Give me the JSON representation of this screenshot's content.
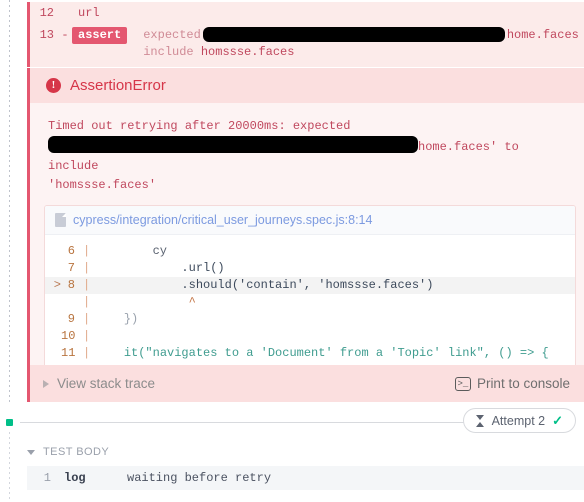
{
  "command_log": {
    "rows": [
      {
        "number": "12",
        "dash": "",
        "name": "url",
        "is_assert": false,
        "message": ""
      },
      {
        "number": "13",
        "dash": "-",
        "name": "assert",
        "is_assert": true,
        "message_pre": "expected",
        "message_redacted_tail": "home.faces to",
        "message_line2_label": "include",
        "message_line2_value": "homssse.faces"
      }
    ]
  },
  "error": {
    "icon": "error-circle-icon",
    "title": "AssertionError",
    "message_line1": "Timed out retrying after 20000ms: expected",
    "message_line2_tail": "home.faces' to include",
    "message_line3": "'homssse.faces'",
    "accent_color": "#e45770",
    "title_color": "#d63649",
    "header_bg": "#fbdfdf",
    "body_bg": "#fdf3f3"
  },
  "code_frame": {
    "file_icon": "file-icon",
    "file_path": "cypress/integration/critical_user_journeys.spec.js:8:14",
    "file_link_color": "#7c9ae0",
    "lines": [
      {
        "marker": "",
        "number": "6",
        "pipe": "|",
        "indent": 8,
        "text": "cy",
        "highlight": false,
        "kind": "plain"
      },
      {
        "marker": "",
        "number": "7",
        "pipe": "|",
        "indent": 12,
        "text": ".url()",
        "highlight": false,
        "kind": "call"
      },
      {
        "marker": ">",
        "number": "8",
        "pipe": "|",
        "indent": 12,
        "text": ".should('contain', 'homssse.faces')",
        "highlight": true,
        "kind": "should"
      },
      {
        "marker": "",
        "number": "",
        "pipe": "|",
        "indent": 13,
        "text": "^",
        "highlight": false,
        "kind": "caret"
      },
      {
        "marker": "",
        "number": "9",
        "pipe": "|",
        "indent": 4,
        "text": "})",
        "highlight": false,
        "kind": "punct"
      },
      {
        "marker": "",
        "number": "10",
        "pipe": "|",
        "indent": 0,
        "text": "",
        "highlight": false,
        "kind": "plain"
      },
      {
        "marker": "",
        "number": "11",
        "pipe": "|",
        "indent": 4,
        "text": "it(\"navigates to a 'Document' from a 'Topic' link\", () => {",
        "highlight": false,
        "kind": "it"
      }
    ]
  },
  "error_footer": {
    "stack_toggle_label": "View stack trace",
    "stack_toggle_icon": "chevron-right-icon",
    "print_console_label": "Print to console",
    "print_console_icon": "console-icon",
    "console_icon_glyph": ">_"
  },
  "attempt": {
    "label": "Attempt 2",
    "hourglass_icon": "hourglass-icon",
    "status_icon": "check-icon",
    "status_glyph": "✓",
    "status_color": "#00bf88",
    "dot_color": "#00bf88"
  },
  "test_body": {
    "toggle_icon": "chevron-down-icon",
    "header_label": "TEST BODY",
    "rows": [
      {
        "number": "1",
        "name": "log",
        "message": "waiting before retry"
      }
    ]
  }
}
